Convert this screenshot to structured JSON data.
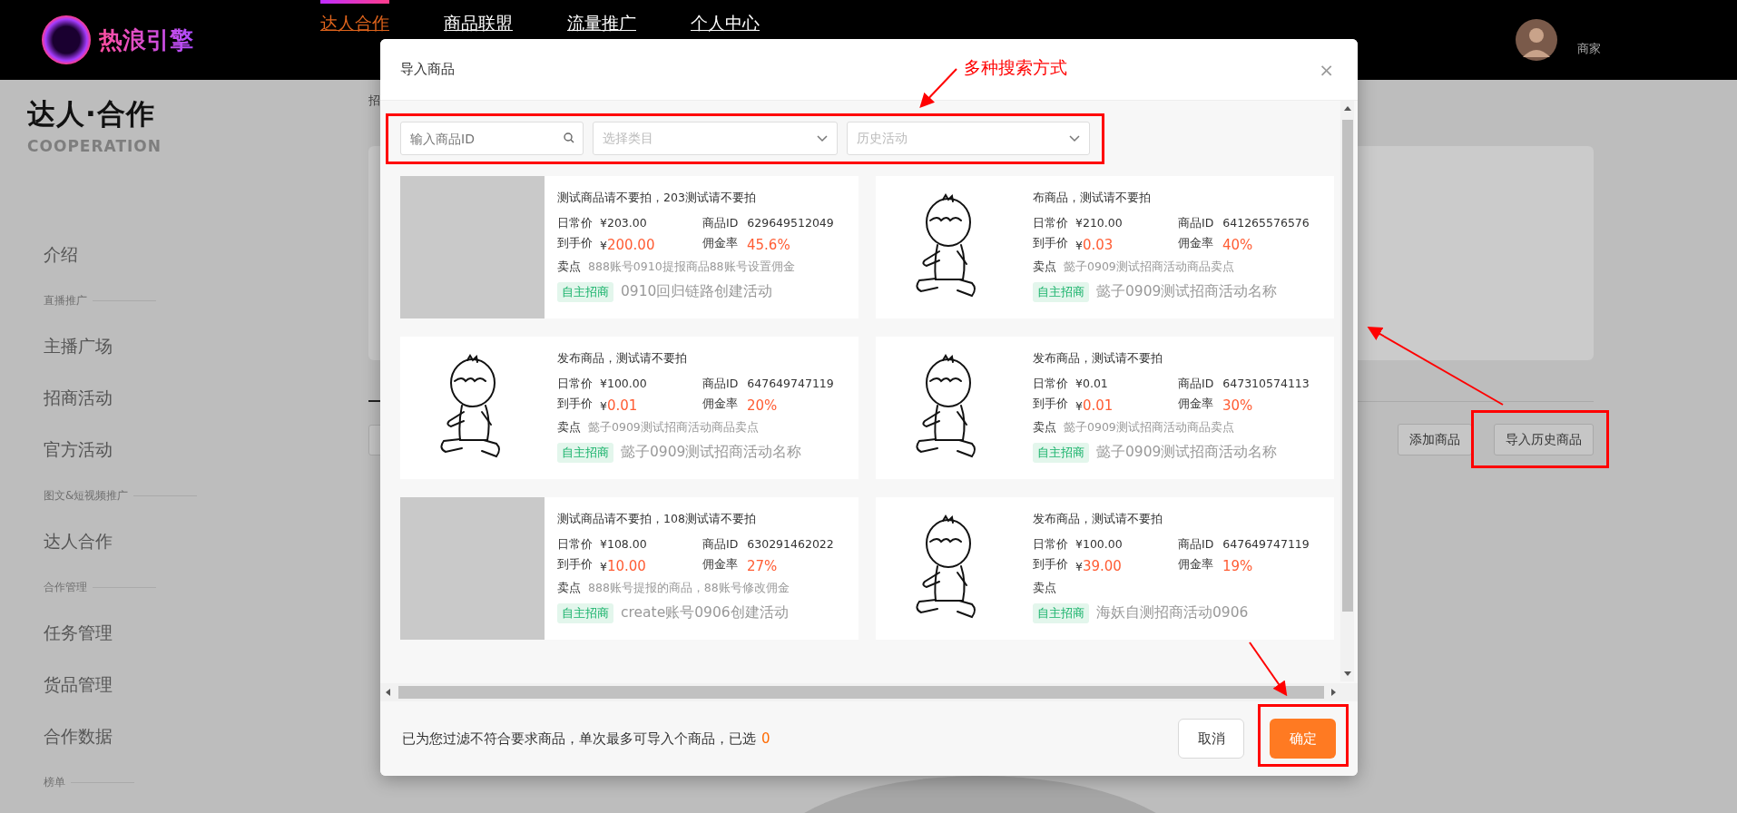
{
  "header": {
    "logo_text": "热浪引擎",
    "nav": [
      {
        "label": "达人合作",
        "selected": true
      },
      {
        "label": "商品联盟",
        "selected": false
      },
      {
        "label": "流量推广",
        "selected": false
      },
      {
        "label": "个人中心",
        "selected": false
      }
    ],
    "user_role": "商家"
  },
  "sidebar": {
    "title": "达人·合作",
    "subtitle": "COOPERATION",
    "items": [
      {
        "kind": "link",
        "label": "介绍"
      },
      {
        "kind": "section",
        "label": "直播推广"
      },
      {
        "kind": "link",
        "label": "主播广场"
      },
      {
        "kind": "link",
        "label": "招商活动"
      },
      {
        "kind": "link",
        "label": "官方活动"
      },
      {
        "kind": "section",
        "label": "图文&短视频推广"
      },
      {
        "kind": "link",
        "label": "达人合作"
      },
      {
        "kind": "section",
        "label": "合作管理"
      },
      {
        "kind": "link",
        "label": "任务管理"
      },
      {
        "kind": "link",
        "label": "货品管理"
      },
      {
        "kind": "link",
        "label": "合作数据"
      },
      {
        "kind": "section",
        "label": "榜单"
      }
    ]
  },
  "main": {
    "breadcrumb": "招",
    "buttons": [
      {
        "label": "添加商品"
      },
      {
        "label": "导入历史商品"
      }
    ]
  },
  "modal": {
    "title": "导入商品",
    "close": "×",
    "search": {
      "placeholder": "输入商品ID"
    },
    "selects": [
      {
        "placeholder": "选择类目"
      },
      {
        "placeholder": "历史活动"
      }
    ],
    "products": [
      {
        "kind": "placeholder",
        "title": "测试商品请不要拍，203测试请不要拍",
        "labels": [
          "日常价",
          "商品ID",
          "到手价",
          "佣金率",
          "卖点"
        ],
        "daily_price": "¥203.00",
        "product_id": "629649512049",
        "currency": "¥",
        "final_price": "200.00",
        "commission": "45.6%",
        "selling_point": "888账号0910提报商品88账号设置佣金",
        "tag": "自主招商",
        "activity": "0910回归链路创建活动"
      },
      {
        "kind": "figure",
        "title": "布商品，测试请不要拍",
        "labels": [
          "日常价",
          "商品ID",
          "到手价",
          "佣金率",
          "卖点"
        ],
        "daily_price": "¥210.00",
        "product_id": "641265576576",
        "currency": "¥",
        "final_price": "0.03",
        "commission": "40%",
        "selling_point": "懿子0909测试招商活动商品卖点",
        "tag": "自主招商",
        "activity": "懿子0909测试招商活动名称"
      },
      {
        "kind": "figure",
        "title": "发布商品，测试请不要拍",
        "labels": [
          "日常价",
          "商品ID",
          "到手价",
          "佣金率",
          "卖点"
        ],
        "daily_price": "¥100.00",
        "product_id": "647649747119",
        "currency": "¥",
        "final_price": "0.01",
        "commission": "20%",
        "selling_point": "懿子0909测试招商活动商品卖点",
        "tag": "自主招商",
        "activity": "懿子0909测试招商活动名称"
      },
      {
        "kind": "figure",
        "title": "发布商品，测试请不要拍",
        "labels": [
          "日常价",
          "商品ID",
          "到手价",
          "佣金率",
          "卖点"
        ],
        "daily_price": "¥0.01",
        "product_id": "647310574113",
        "currency": "¥",
        "final_price": "0.01",
        "commission": "30%",
        "selling_point": "懿子0909测试招商活动商品卖点",
        "tag": "自主招商",
        "activity": "懿子0909测试招商活动名称"
      },
      {
        "kind": "placeholder",
        "title": "测试商品请不要拍，108测试请不要拍",
        "labels": [
          "日常价",
          "商品ID",
          "到手价",
          "佣金率",
          "卖点"
        ],
        "daily_price": "¥108.00",
        "product_id": "630291462022",
        "currency": "¥",
        "final_price": "10.00",
        "commission": "27%",
        "selling_point": "888账号提报的商品，88账号修改佣金",
        "tag": "自主招商",
        "activity": "create账号0906创建活动"
      },
      {
        "kind": "figure",
        "title": "发布商品，测试请不要拍",
        "labels": [
          "日常价",
          "商品ID",
          "到手价",
          "佣金率",
          "卖点"
        ],
        "daily_price": "¥100.00",
        "product_id": "647649747119",
        "currency": "¥",
        "final_price": "39.00",
        "commission": "19%",
        "tag": "自主招商",
        "activity": "海妖自测招商活动0906"
      }
    ],
    "footer": {
      "note": "已为您过滤不符合要求商品，单次最多可导入个商品，已选",
      "selected_count": "0"
    },
    "buttons": [
      {
        "label": "取消",
        "kind": "secondary"
      },
      {
        "label": "确定",
        "kind": "primary"
      }
    ]
  },
  "annotation": {
    "text": "多种搜索方式"
  }
}
